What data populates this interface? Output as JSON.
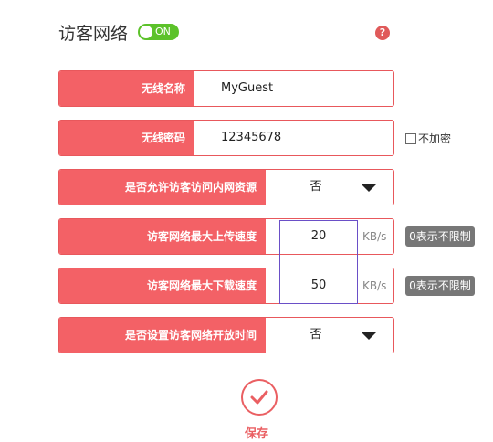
{
  "header": {
    "title": "访客网络",
    "toggle_label": "ON",
    "help_icon": "?"
  },
  "form": {
    "ssid_label": "无线名称",
    "ssid_value": "MyGuest",
    "password_label": "无线密码",
    "password_value": "12345678",
    "no_encrypt_label": "不加密",
    "allow_intranet_label": "是否允许访客访问内网资源",
    "allow_intranet_value": "否",
    "upload_label": "访客网络最大上传速度",
    "upload_value": "20",
    "upload_unit": "KB/s",
    "upload_hint": "0表示不限制",
    "download_label": "访客网络最大下载速度",
    "download_value": "50",
    "download_unit": "KB/s",
    "download_hint": "0表示不限制",
    "schedule_label": "是否设置访客网络开放时间",
    "schedule_value": "否"
  },
  "footer": {
    "save_label": "保存"
  },
  "colors": {
    "accent": "#f36166",
    "toggle_on": "#5cc22a",
    "hint_badge": "#777777"
  }
}
